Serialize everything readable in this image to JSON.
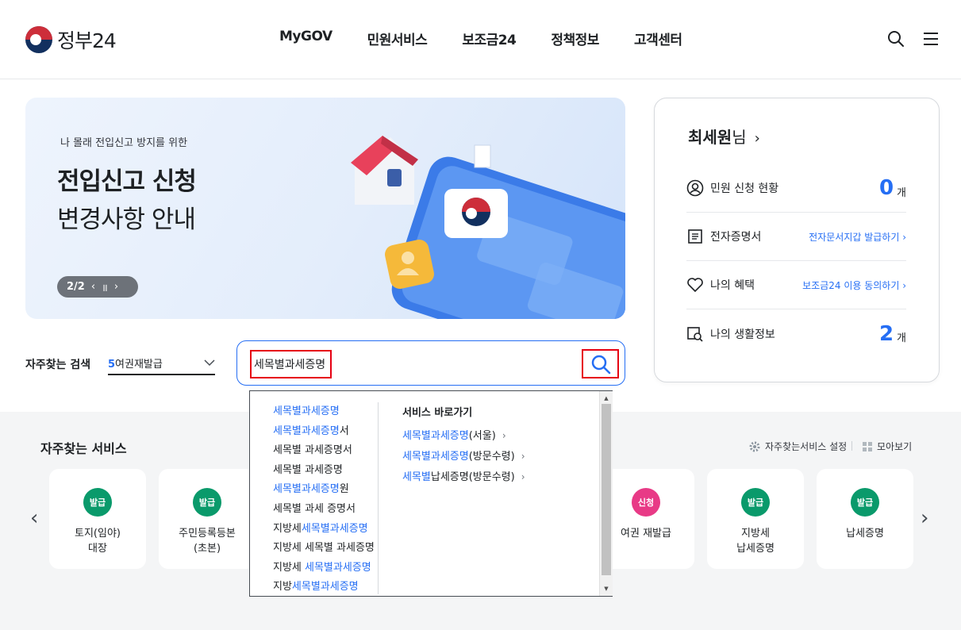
{
  "header": {
    "logo_text": "정부24",
    "nav": [
      "MyGOV",
      "민원서비스",
      "보조금24",
      "정책정보",
      "고객센터"
    ],
    "search_icon": "search-icon",
    "menu_icon": "hamburger-menu-icon"
  },
  "banner": {
    "subtitle": "나 몰래 전입신고 방지를 위한",
    "title_line1": "전입신고 신청",
    "title_line2": "변경사항 안내",
    "pager": "2/2",
    "prev": "‹",
    "pause": "॥",
    "next": "›"
  },
  "search": {
    "label": "자주찾는 검색",
    "fav_number": "5",
    "fav_text": "여권재발급",
    "query": "세목별과세증명"
  },
  "autocomplete": {
    "suggestions": [
      {
        "hl": "세목별과세증명",
        "rest": ""
      },
      {
        "hl": "세목별과세증명",
        "rest": "서"
      },
      {
        "hl": "",
        "rest": "세목별 과세증명서"
      },
      {
        "hl": "",
        "rest": "세목별 과세증명"
      },
      {
        "hl": "세목별과세증명",
        "rest": "원"
      },
      {
        "hl": "",
        "rest": "세목별 과세 증명서"
      },
      {
        "pre": "지방세",
        "hl": "세목별과세증명"
      },
      {
        "pre": "지방세 세목별 과세증명",
        "hl": ""
      },
      {
        "pre": "지방세 ",
        "hl": "세목별과세증명"
      },
      {
        "pre": "지방",
        "hl": "세목별과세증명"
      }
    ],
    "service_title": "서비스 바로가기",
    "services": [
      {
        "hl": "세목별과세증명",
        "rest": "(서울)"
      },
      {
        "hl": "세목별과세증명",
        "rest": "(방문수령)"
      },
      {
        "hl": "세목별",
        "rest": "납세증명(방문수령)"
      }
    ]
  },
  "user": {
    "name": "최세원",
    "suffix": "님",
    "rows": [
      {
        "label": "민원 신청 현황",
        "value": "0",
        "unit": "개"
      },
      {
        "label": "전자증명서",
        "link": "전자문서지갑 발급하기"
      },
      {
        "label": "나의 혜택",
        "link": "보조금24 이용 동의하기"
      },
      {
        "label": "나의 생활정보",
        "value": "2",
        "unit": "개"
      }
    ]
  },
  "favorites": {
    "title": "자주찾는 서비스",
    "settings": "자주찾는서비스 설정",
    "view_all": "모아보기",
    "cards": [
      {
        "badge": "발급",
        "label": "토지(임야)\n대장",
        "color": "#0a9a6b"
      },
      {
        "badge": "발급",
        "label": "주민등록등본\n(초본)",
        "color": "#0a9a6b"
      },
      {
        "badge": "신청",
        "label": "여권 재발급",
        "color": "#e83a86"
      },
      {
        "badge": "발급",
        "label": "지방세\n납세증명",
        "color": "#0a9a6b"
      },
      {
        "badge": "발급",
        "label": "납세증명",
        "color": "#0a9a6b"
      }
    ]
  }
}
